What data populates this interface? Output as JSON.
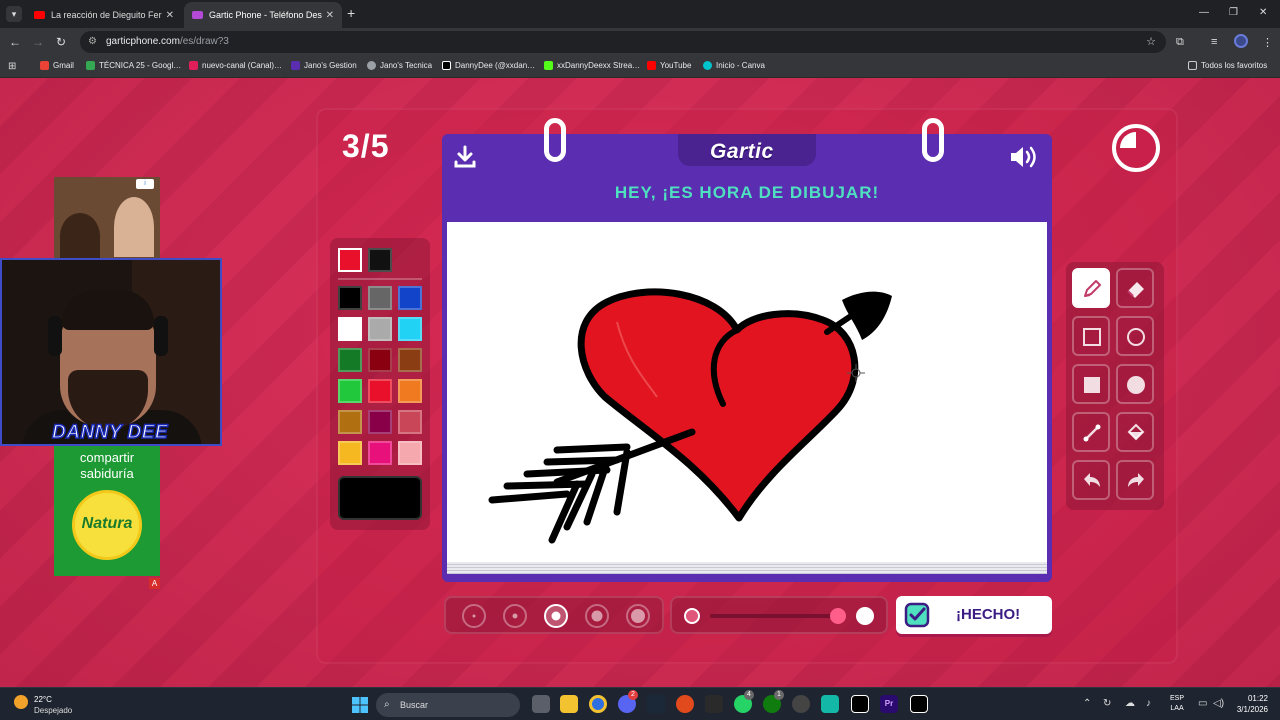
{
  "browser": {
    "tabs": [
      {
        "title": "La reacción de Dieguito Fernan…",
        "favicon_color": "#ff0000"
      },
      {
        "title": "Gartic Phone - Teléfono Descon…",
        "favicon_color": "#b24ad6"
      }
    ],
    "url_host": "garticphone.com",
    "url_path": "/es/draw?3",
    "bookmarks": [
      {
        "label": "Gmail",
        "color": "#ea4335"
      },
      {
        "label": "TÉCNICA 25 - Googl…",
        "color": "#34a853"
      },
      {
        "label": "nuevo-canal (Canal)…",
        "color": "#e01e5a"
      },
      {
        "label": "Jano's Gestion",
        "color": "#5b2db0"
      },
      {
        "label": "Jano's Tecnica",
        "color": "#9aa0a6"
      },
      {
        "label": "DannyDee (@xxdan…",
        "color": "#000000"
      },
      {
        "label": "xxDannyDeexx Strea…",
        "color": "#53fc18"
      },
      {
        "label": "YouTube",
        "color": "#ff0000"
      },
      {
        "label": "Inicio - Canva",
        "color": "#00c4cc"
      }
    ],
    "all_bookmarks_label": "Todos los favoritos"
  },
  "game": {
    "round": "3/5",
    "logo": "Gartic",
    "banner": "HEY, ¡ES HORA DE DIBUJAR!",
    "done_label": "¡HECHO!",
    "timer_remaining_fraction": 0.75,
    "palette": {
      "selected": [
        "#e8102a",
        "#111111"
      ],
      "colors": [
        "#000000",
        "#666666",
        "#1144c8",
        "#ffffff",
        "#aaaaaa",
        "#22d2f5",
        "#157a26",
        "#8a0010",
        "#8a3c12",
        "#22c83c",
        "#e8102a",
        "#f07a20",
        "#b07012",
        "#8a0048",
        "#c84658",
        "#f5b820",
        "#e8107a",
        "#f5a8ae"
      ],
      "current_color": "#000000"
    },
    "tools": [
      "pencil-tool",
      "eraser-tool",
      "rectangle-tool",
      "ellipse-tool",
      "filled-rectangle-tool",
      "filled-ellipse-tool",
      "line-tool",
      "fill-bucket-tool",
      "undo-tool",
      "redo-tool"
    ],
    "selected_tool": "pencil-tool",
    "brush_sizes": [
      1,
      2,
      3,
      4,
      5
    ],
    "selected_brush_size": 3,
    "opacity_level": 1.0
  },
  "overlays": {
    "ad_badge": "i",
    "streamer_name": "DANNY DEE",
    "ad_text": "compartir sabiduría",
    "ad_brand": "Natura",
    "adchoice": "A"
  },
  "taskbar": {
    "temperature": "22°C",
    "condition": "Despejado",
    "search_placeholder": "Buscar",
    "lang": "ESP",
    "lang2": "LAA",
    "time": "01:22",
    "date": "3/1/2026",
    "badges": {
      "discord": "2",
      "whatsapp": "4",
      "xbox": "1"
    }
  }
}
